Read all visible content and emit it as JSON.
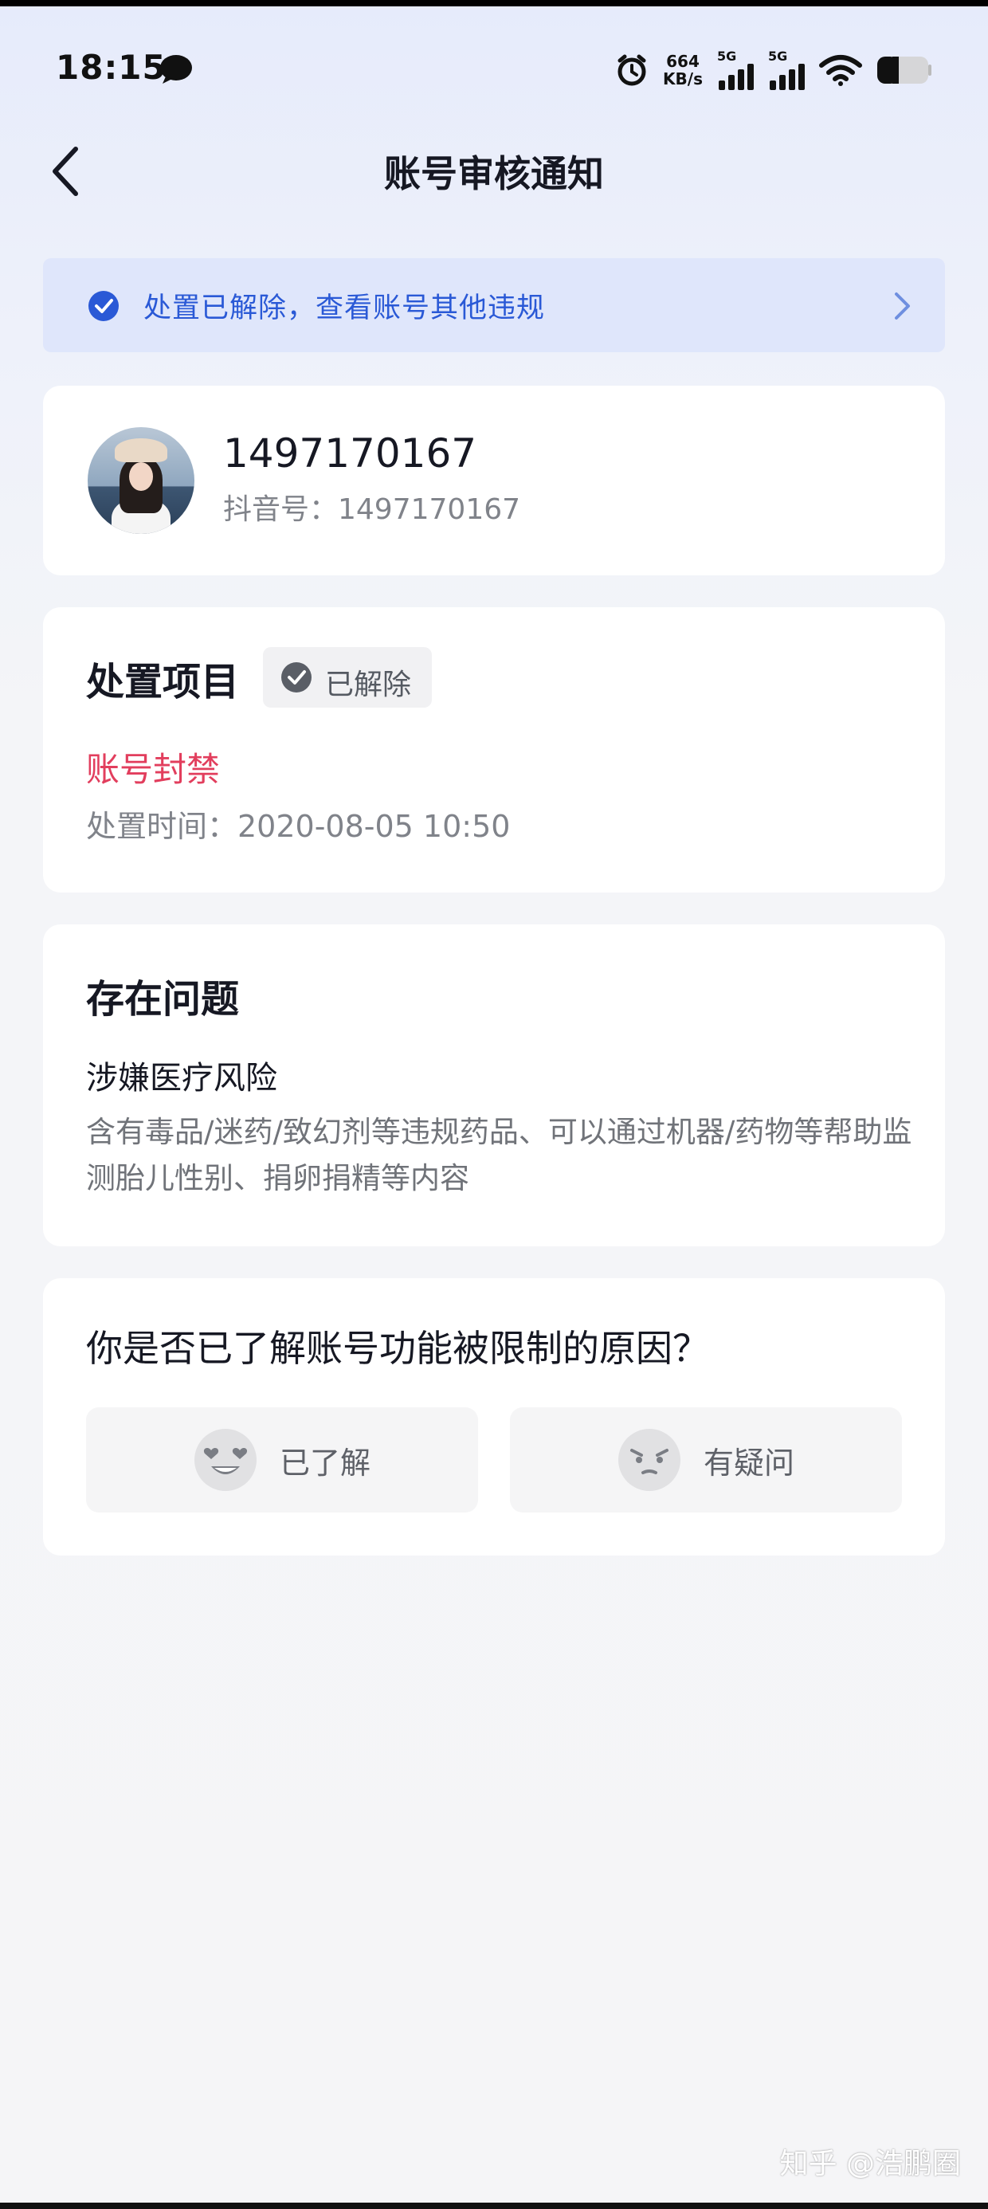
{
  "status_bar": {
    "time": "18:15",
    "net_speed_value": "664",
    "net_speed_unit": "KB/s",
    "signal_1_label": "5G",
    "signal_2_label": "5G"
  },
  "nav": {
    "title": "账号审核通知"
  },
  "banner": {
    "text": "处置已解除，查看账号其他违规",
    "accent_color": "#2a59d6"
  },
  "profile": {
    "name": "1497170167",
    "douyin_id": "抖音号：1497170167"
  },
  "disposal": {
    "section_title": "处置项目",
    "status_badge": "已解除",
    "action": "账号封禁",
    "time": "处置时间：2020-08-05 10:50",
    "action_color": "#e23e5d"
  },
  "issue": {
    "section_title": "存在问题",
    "category": "涉嫌医疗风险",
    "description": "含有毒品/迷药/致幻剂等违规药品、可以通过机器/药物等帮助监测胎儿性别、捐卵捐精等内容"
  },
  "feedback": {
    "question": "你是否已了解账号功能被限制的原因？",
    "options": [
      {
        "label": "已了解",
        "icon": "heart-eyes-emoji-icon"
      },
      {
        "label": "有疑问",
        "icon": "confused-emoji-icon"
      }
    ]
  },
  "watermark": "知乎 @浩鹏圈"
}
